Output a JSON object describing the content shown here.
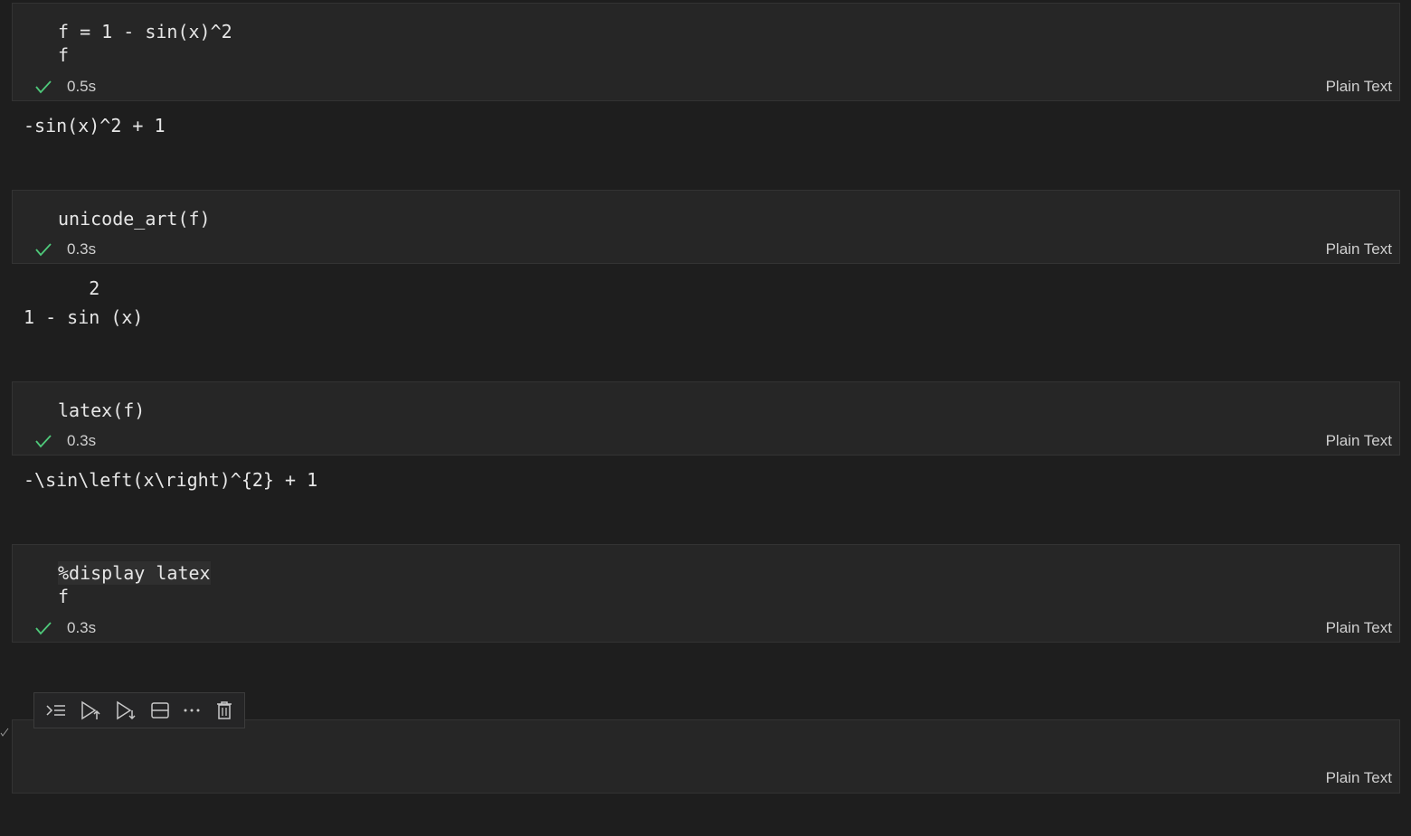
{
  "cells": [
    {
      "code": [
        "f = 1 - sin(x)^2",
        "f"
      ],
      "timing": "0.5s",
      "language": "Plain Text",
      "output": [
        "-sin(x)^2 + 1"
      ]
    },
    {
      "code": [
        "unicode_art(f)"
      ],
      "timing": "0.3s",
      "language": "Plain Text",
      "output": [
        "      2",
        "1 - sin (x)"
      ]
    },
    {
      "code": [
        "latex(f)"
      ],
      "timing": "0.3s",
      "language": "Plain Text",
      "output": [
        "-\\sin\\left(x\\right)^{2} + 1"
      ]
    },
    {
      "code": [
        "%display latex",
        "f"
      ],
      "timing": "0.3s",
      "language": "Plain Text",
      "output": []
    },
    {
      "code": [],
      "timing": "",
      "language": "Plain Text",
      "output": []
    }
  ],
  "toolbar": {
    "buttons": [
      {
        "name": "execute-above-icon"
      },
      {
        "name": "run-above-icon"
      },
      {
        "name": "run-below-icon"
      },
      {
        "name": "split-cell-icon"
      },
      {
        "name": "more-actions-icon"
      },
      {
        "name": "delete-cell-icon"
      }
    ]
  },
  "colors": {
    "background": "#1e1e1e",
    "cell_background": "#262626",
    "success_check": "#4ec97a",
    "text": "#e6e6e6"
  }
}
